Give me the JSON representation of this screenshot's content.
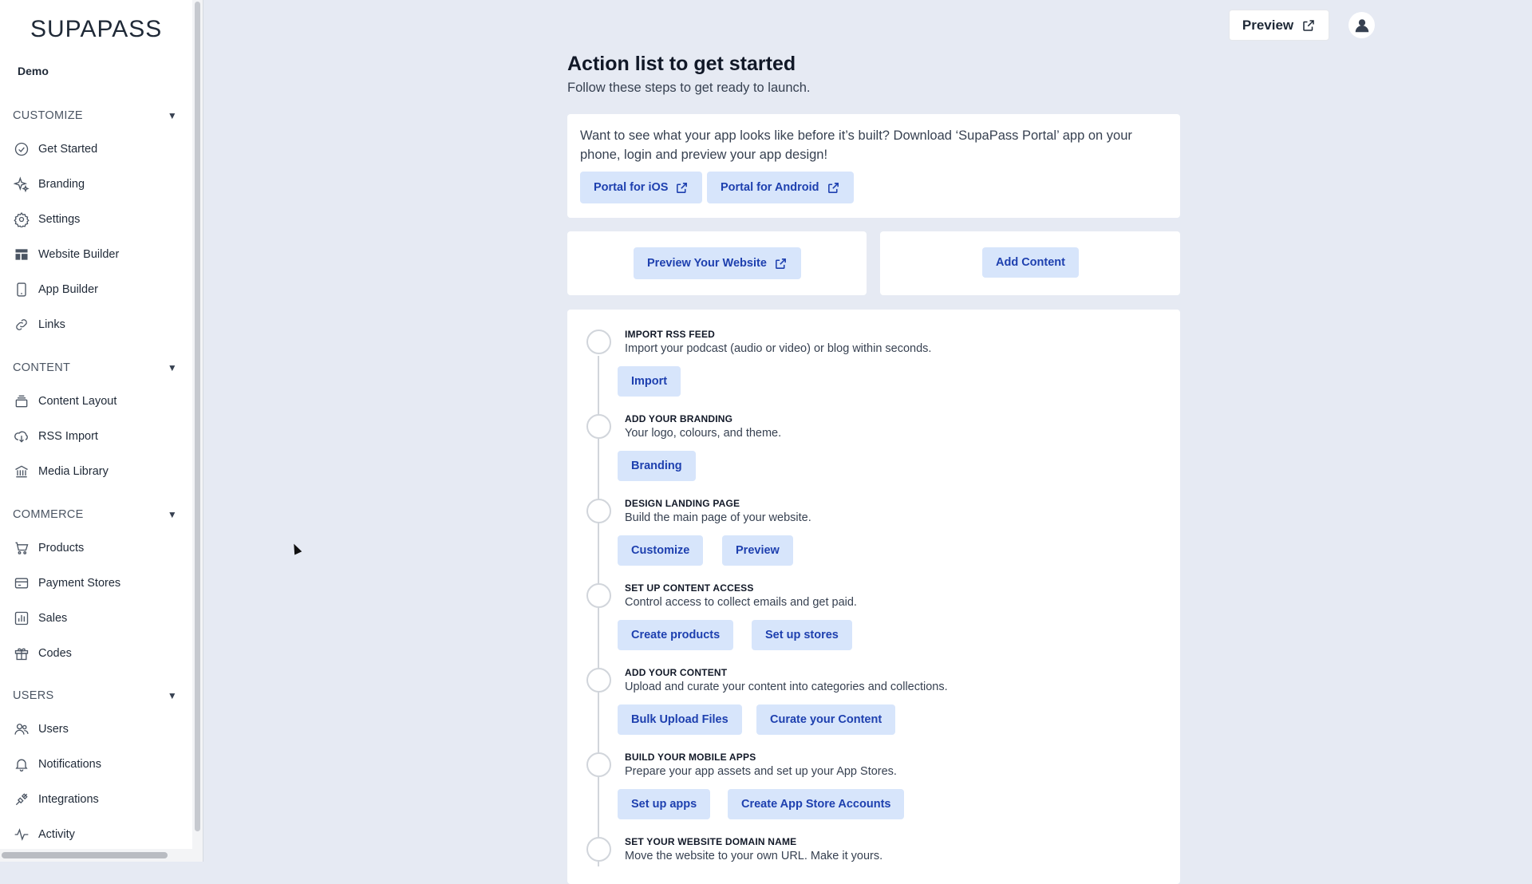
{
  "sidebar": {
    "logo": "SUPAPASS",
    "org": "Demo",
    "sections": [
      {
        "label": "CUSTOMIZE",
        "items": [
          "Get Started",
          "Branding",
          "Settings",
          "Website Builder",
          "App Builder",
          "Links"
        ]
      },
      {
        "label": "CONTENT",
        "items": [
          "Content Layout",
          "RSS Import",
          "Media Library"
        ]
      },
      {
        "label": "COMMERCE",
        "items": [
          "Products",
          "Payment Stores",
          "Sales",
          "Codes"
        ]
      },
      {
        "label": "USERS",
        "items": [
          "Users",
          "Notifications",
          "Integrations",
          "Activity"
        ]
      }
    ]
  },
  "header": {
    "preview_label": "Preview"
  },
  "main": {
    "title": "Action list to get started",
    "subtitle": "Follow these steps to get ready to launch.",
    "portal": {
      "text": "Want to see what your app looks like before it’s built? Download ‘SupaPass Portal’ app on your phone, login and preview your app design!",
      "ios_label": "Portal for iOS",
      "android_label": "Portal for Android"
    },
    "preview_website_label": "Preview Your Website",
    "add_content_label": "Add Content",
    "steps": [
      {
        "title": "IMPORT RSS FEED",
        "desc": "Import your podcast (audio or video) or blog within seconds.",
        "buttons": [
          "Import"
        ]
      },
      {
        "title": "ADD YOUR BRANDING",
        "desc": "Your logo, colours, and theme.",
        "buttons": [
          "Branding"
        ]
      },
      {
        "title": "DESIGN LANDING PAGE",
        "desc": "Build the main page of your website.",
        "buttons": [
          "Customize",
          "Preview"
        ]
      },
      {
        "title": "SET UP CONTENT ACCESS",
        "desc": "Control access to collect emails and get paid.",
        "buttons": [
          "Create products",
          "Set up stores"
        ]
      },
      {
        "title": "ADD YOUR CONTENT",
        "desc": "Upload and curate your content into categories and collections.",
        "buttons": [
          "Bulk Upload Files",
          "Curate your Content"
        ]
      },
      {
        "title": "BUILD YOUR MOBILE APPS",
        "desc": "Prepare your app assets and set up your App Stores.",
        "buttons": [
          "Set up apps",
          "Create App Store Accounts"
        ]
      },
      {
        "title": "SET YOUR WEBSITE DOMAIN NAME",
        "desc": "Move the website to your own URL. Make it yours.",
        "buttons": []
      }
    ]
  }
}
